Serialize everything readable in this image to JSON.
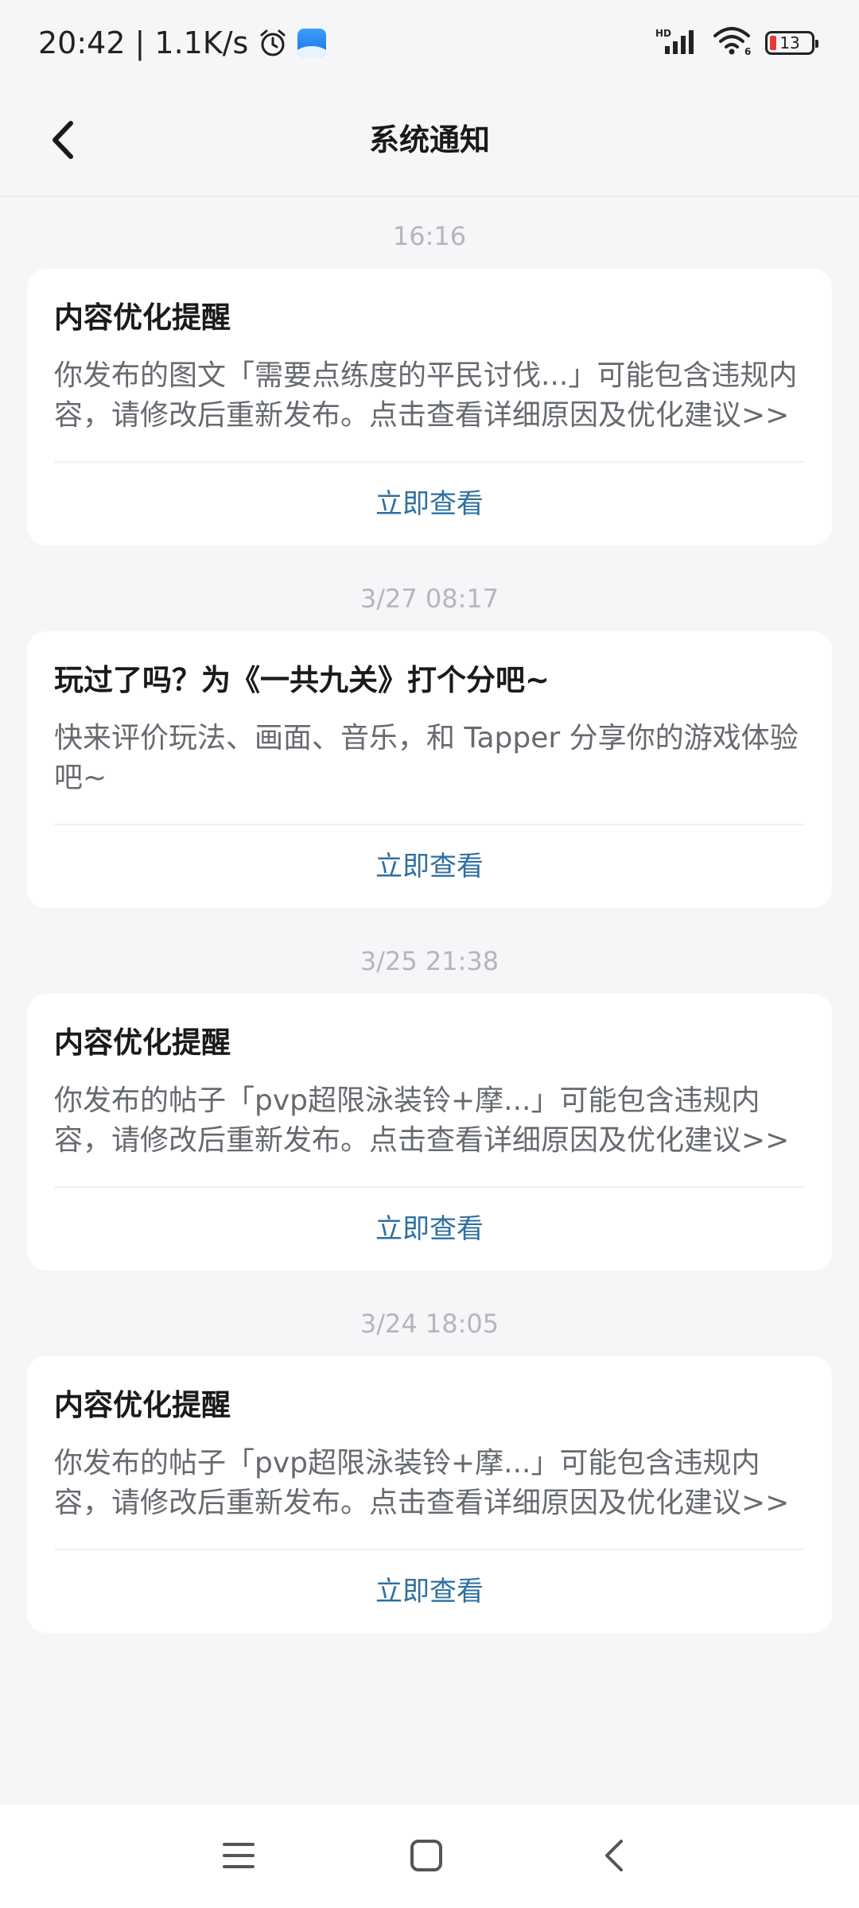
{
  "status_bar": {
    "time": "20:42",
    "net_speed": "| 1.1K/s",
    "icons": [
      "alarm-icon",
      "gallery-icon",
      "hd-signal-icon",
      "wifi-icon",
      "battery-icon"
    ],
    "battery_level": "13",
    "signal_label": "HD",
    "wifi_sub": "6"
  },
  "header": {
    "title": "系统通知",
    "back_icon": "chevron-left-icon"
  },
  "notices": [
    {
      "time": "16:16",
      "title": "内容优化提醒",
      "body": "你发布的图文「需要点练度的平民讨伐...」可能包含违规内容，请修改后重新发布。点击查看详细原因及优化建议>>",
      "action": "立即查看"
    },
    {
      "time": "3/27  08:17",
      "title": "玩过了吗？为《一共九关》打个分吧~",
      "body": "快来评价玩法、画面、音乐，和 Tapper 分享你的游戏体验吧~",
      "action": "立即查看"
    },
    {
      "time": "3/25  21:38",
      "title": "内容优化提醒",
      "body": "你发布的帖子「pvp超限泳装铃+摩...」可能包含违规内容，请修改后重新发布。点击查看详细原因及优化建议>>",
      "action": "立即查看"
    },
    {
      "time": "3/24  18:05",
      "title": "内容优化提醒",
      "body": "你发布的帖子「pvp超限泳装铃+摩...」可能包含违规内容，请修改后重新发布。点击查看详细原因及优化建议>>",
      "action": "立即查看"
    }
  ],
  "system_nav": {
    "icons": [
      "menu-icon",
      "home-icon",
      "back-icon"
    ]
  },
  "colors": {
    "background": "#f5f6f8",
    "card": "#ffffff",
    "action_link": "#2f6f9f",
    "timestamp": "#b4b6ba",
    "body_text": "#666a70"
  }
}
